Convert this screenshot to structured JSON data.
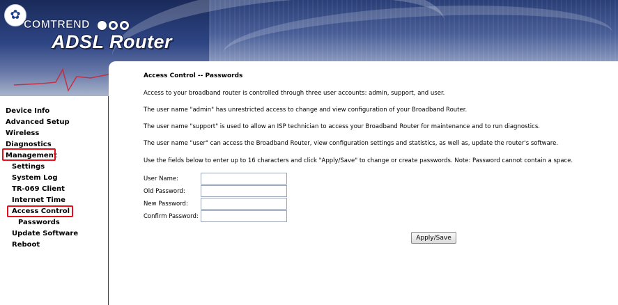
{
  "header": {
    "brand": "COMTREND",
    "product": "ADSL Router",
    "logo_icon": "comtrend-flower-logo-icon"
  },
  "sidebar": {
    "items": [
      {
        "label": "Device Info",
        "level": 1
      },
      {
        "label": "Advanced Setup",
        "level": 1
      },
      {
        "label": "Wireless",
        "level": 1
      },
      {
        "label": "Diagnostics",
        "level": 1
      },
      {
        "label": "Management",
        "level": 1,
        "highlighted": true
      },
      {
        "label": "Settings",
        "level": 2
      },
      {
        "label": "System Log",
        "level": 2
      },
      {
        "label": "TR-069 Client",
        "level": 2
      },
      {
        "label": "Internet Time",
        "level": 2
      },
      {
        "label": "Access Control",
        "level": 2,
        "highlighted": true
      },
      {
        "label": "Passwords",
        "level": 3
      },
      {
        "label": "Update Software",
        "level": 2
      },
      {
        "label": "Reboot",
        "level": 2
      }
    ],
    "highlight_color": "#e0121b"
  },
  "main": {
    "title": "Access Control -- Passwords",
    "paragraphs": [
      "Access to your broadband router is controlled through three user accounts: admin, support, and user.",
      "The user name \"admin\" has unrestricted access to change and view configuration of your Broadband Router.",
      "The user name \"support\" is used to allow an ISP technician to access your Broadband Router for maintenance and to run diagnostics.",
      "The user name \"user\" can access the Broadband Router, view configuration settings and statistics, as well as, update the router's software.",
      "Use the fields below to enter up to 16 characters and click \"Apply/Save\" to change or create passwords. Note: Password cannot contain a space."
    ],
    "form": {
      "user_name_label": "User Name:",
      "user_name_value": "",
      "old_password_label": "Old Password:",
      "old_password_value": "",
      "new_password_label": "New Password:",
      "new_password_value": "",
      "confirm_password_label": "Confirm Password:",
      "confirm_password_value": ""
    },
    "apply_label": "Apply/Save"
  },
  "colors": {
    "banner_dark": "#2a3f78",
    "sidebar_border": "#b0121b",
    "highlight": "#e0121b"
  }
}
